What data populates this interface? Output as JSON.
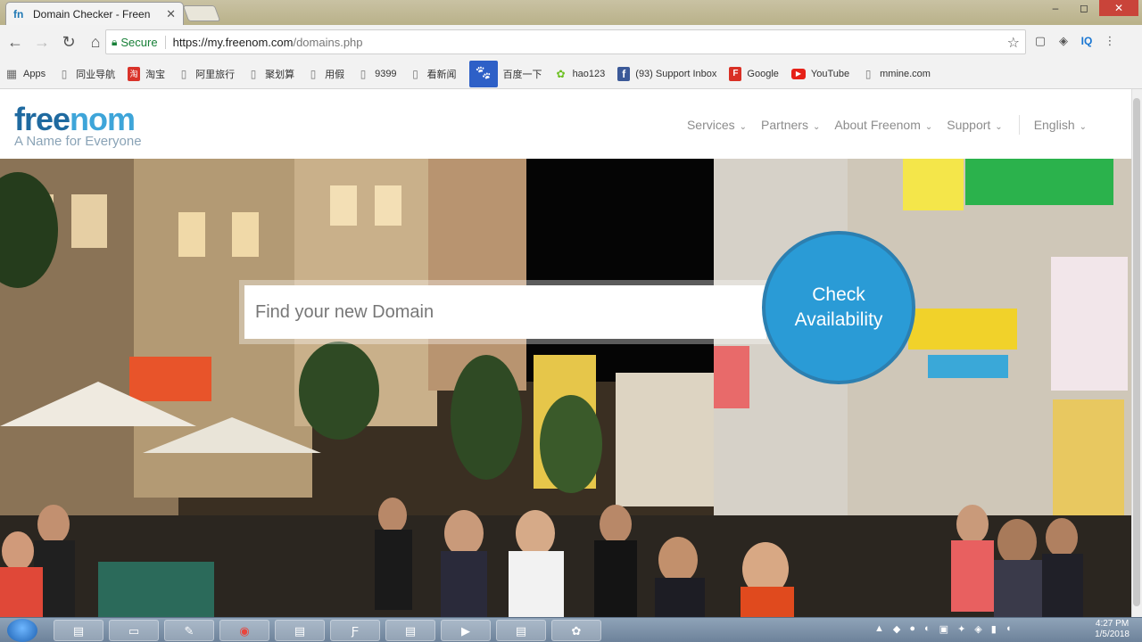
{
  "browser": {
    "tab_title": "Domain Checker - Freen",
    "tab_icon": "fn",
    "window_controls": {
      "minimize": "–",
      "maximize": "◻",
      "close": "✕"
    }
  },
  "address_bar": {
    "secure_label": "Secure",
    "url_host": "https://my.freenom.com",
    "url_path": "/domains.php"
  },
  "extensions": {
    "iq_label": "IQ"
  },
  "bookmarks": [
    {
      "label": "Apps",
      "icon": "apps-icon"
    },
    {
      "label": "同业导航",
      "icon": "page-icon"
    },
    {
      "label": "淘宝",
      "icon": "taobao-icon"
    },
    {
      "label": "阿里旅行",
      "icon": "page-icon"
    },
    {
      "label": "聚划算",
      "icon": "page-icon"
    },
    {
      "label": "用假",
      "icon": "page-icon"
    },
    {
      "label": "9399",
      "icon": "page-icon"
    },
    {
      "label": "看新闻",
      "icon": "page-icon"
    },
    {
      "label": "百度一下",
      "icon": "baidu-icon"
    },
    {
      "label": "hao123",
      "icon": "hao123-icon"
    },
    {
      "label": "(93) Support Inbox",
      "icon": "facebook-icon"
    },
    {
      "label": "Google",
      "icon": "google-icon"
    },
    {
      "label": "YouTube",
      "icon": "youtube-icon"
    },
    {
      "label": "mmine.com",
      "icon": "page-icon"
    }
  ],
  "site": {
    "logo_free": "free",
    "logo_nom": "nom",
    "tagline": "A Name for Everyone",
    "nav": [
      {
        "label": "Services",
        "has_dropdown": true
      },
      {
        "label": "Partners",
        "has_dropdown": true
      },
      {
        "label": "About Freenom",
        "has_dropdown": true
      },
      {
        "label": "Support",
        "has_dropdown": true
      }
    ],
    "language": "English"
  },
  "hero": {
    "search_placeholder": "Find your new Domain",
    "check_line1": "Check",
    "check_line2": "Availability",
    "accent_color": "#2a9bd6"
  },
  "taskbar": {
    "clock_time": "4:27 PM",
    "clock_date": "1/5/2018"
  }
}
